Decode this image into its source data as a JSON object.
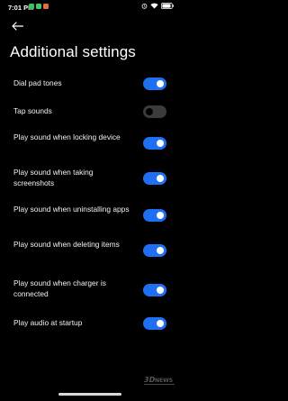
{
  "status_bar": {
    "time": "7:01 PM",
    "notification_icons": [
      {
        "name": "green-app-icon",
        "color": "#3cc35a"
      },
      {
        "name": "green-app-icon-2",
        "color": "#4bc36a"
      },
      {
        "name": "orange-app-icon",
        "color": "#e36c4a"
      }
    ],
    "system_icons": [
      "alarm-icon",
      "wifi-icon",
      "battery-icon"
    ]
  },
  "header": {
    "back_icon": "arrow-left-icon",
    "title": "Additional settings"
  },
  "settings": [
    {
      "label": "Dial pad tones",
      "enabled": true
    },
    {
      "label": "Tap sounds",
      "enabled": false
    },
    {
      "label": "Play sound when locking device",
      "enabled": true
    },
    {
      "label": "Play sound when taking screenshots",
      "enabled": true
    },
    {
      "label": "Play sound when uninstalling apps",
      "enabled": true
    },
    {
      "label": "Play sound when deleting items",
      "enabled": true
    },
    {
      "label": "Play sound when charger is connected",
      "enabled": true
    },
    {
      "label": "Play audio at startup",
      "enabled": true
    }
  ],
  "colors": {
    "background": "#000000",
    "toggle_on": "#1f6ff2",
    "toggle_off": "#3b3b3b",
    "text": "#f2f2f2"
  },
  "watermark": {
    "text": "3DNEWS",
    "icon": "3dnews-logo"
  }
}
